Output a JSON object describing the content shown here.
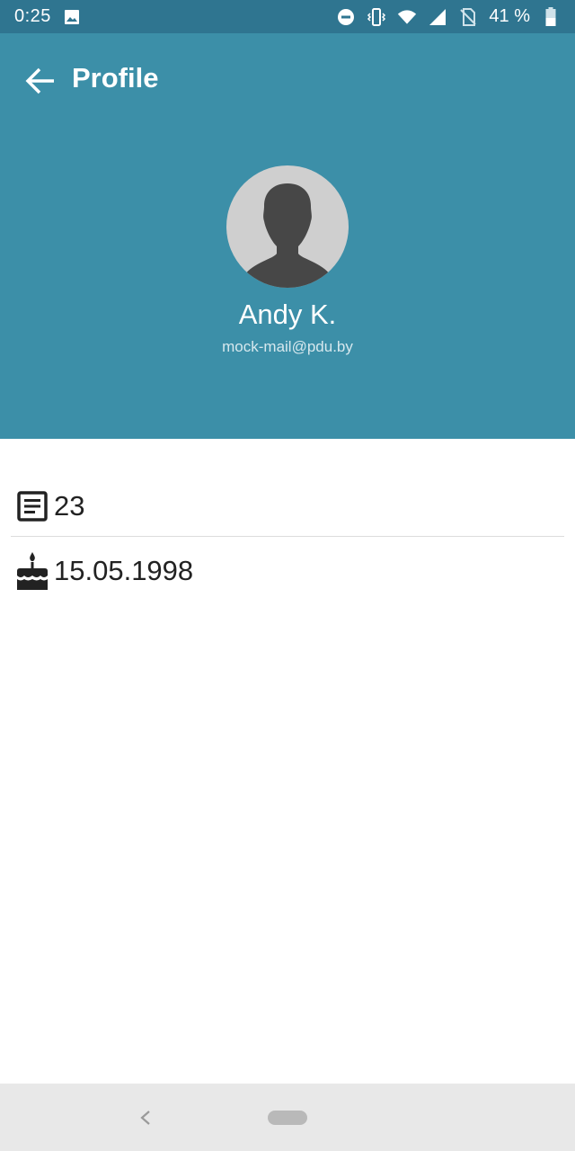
{
  "status_bar": {
    "time": "0:25",
    "battery_text": "41 %",
    "icons": [
      "image-icon",
      "dnd-icon",
      "vibrate-icon",
      "wifi-icon",
      "signal-icon",
      "no-sim-icon",
      "battery-icon"
    ]
  },
  "toolbar": {
    "title": "Profile",
    "back_icon": "arrow-left-icon"
  },
  "profile": {
    "name": "Andy K.",
    "email": "mock-mail@pdu.by",
    "avatar_icon": "person-silhouette-icon"
  },
  "info": {
    "items": [
      {
        "icon": "article-icon",
        "value": "23"
      },
      {
        "icon": "cake-icon",
        "value": "15.05.1998"
      }
    ]
  },
  "nav_bar": {
    "back_icon": "chevron-left-icon",
    "home_icon": "home-pill-icon"
  },
  "colors": {
    "status_bar": "#2f7590",
    "header": "#3c8fa8",
    "text_primary": "#222222",
    "nav_bar": "#e8e8e8"
  }
}
